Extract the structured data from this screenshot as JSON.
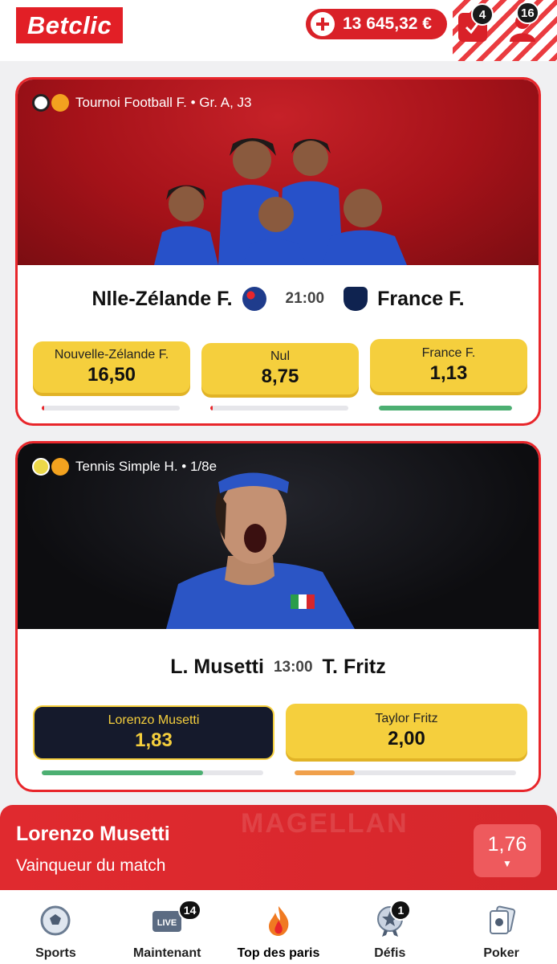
{
  "header": {
    "logo_text": "Betclic",
    "balance": "13 645,32 €",
    "tickets_count": "4",
    "notifications_count": "16"
  },
  "events": [
    {
      "sport_label": "Tournoi Football F. • Gr. A, J3",
      "home": "Nlle-Zélande F.",
      "away": "France F.",
      "time": "21:00",
      "odds": [
        {
          "label": "Nouvelle-Zélande F.",
          "value": "16,50",
          "share": 0.01,
          "color": "#e8262b"
        },
        {
          "label": "Nul",
          "value": "8,75",
          "share": 0.02,
          "color": "#e8262b"
        },
        {
          "label": "France F.",
          "value": "1,13",
          "share": 1.0,
          "color": "#4caf72"
        }
      ]
    },
    {
      "sport_label": "Tennis Simple H. • 1/8e",
      "home": "L. Musetti",
      "away": "T. Fritz",
      "time": "13:00",
      "odds": [
        {
          "label": "Lorenzo Musetti",
          "value": "1,83",
          "share": 0.73,
          "color": "#4caf72",
          "selected": true
        },
        {
          "label": "Taylor Fritz",
          "value": "2,00",
          "share": 0.27,
          "color": "#f0a04b"
        }
      ]
    }
  ],
  "bet_slip": {
    "background_text": "MAGELLAN",
    "player": "Lorenzo Musetti",
    "market": "Vainqueur du match",
    "odd": "1,76"
  },
  "nav": {
    "items": [
      {
        "label": "Sports",
        "icon": "soccer-ball-icon"
      },
      {
        "label": "Maintenant",
        "icon": "live-tv-icon",
        "badge": "14"
      },
      {
        "label": "Top des paris",
        "icon": "flame-icon"
      },
      {
        "label": "Défis",
        "icon": "star-medal-icon",
        "badge": "1"
      },
      {
        "label": "Poker",
        "icon": "poker-cards-icon"
      }
    ]
  }
}
